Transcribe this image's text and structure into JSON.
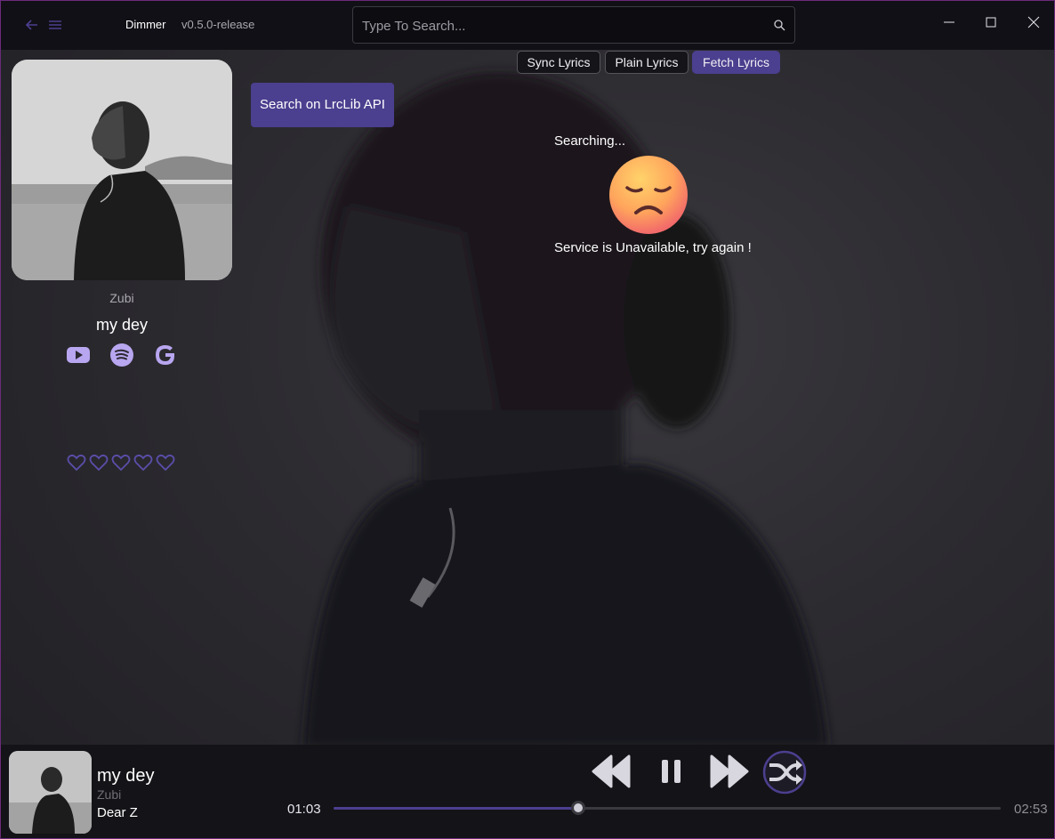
{
  "titlebar": {
    "app_name": "Dimmer",
    "version": "v0.5.0-release",
    "search_placeholder": "Type To Search...",
    "icons": [
      "back-arrow-icon",
      "hamburger-menu-icon",
      "search-icon",
      "minimize-icon",
      "maximize-icon",
      "close-icon"
    ]
  },
  "tabs": [
    {
      "label": "Sync Lyrics",
      "active": false
    },
    {
      "label": "Plain Lyrics",
      "active": false
    },
    {
      "label": "Fetch Lyrics",
      "active": true
    }
  ],
  "now_playing_panel": {
    "artist": "Zubi",
    "song": "my dey",
    "links": [
      "youtube-icon",
      "spotify-icon",
      "google-icon"
    ],
    "rating_hearts": 5,
    "rating_filled": 0
  },
  "lyrics_fetch": {
    "button_label": "Search on LrcLib API",
    "status": "Searching...",
    "emoji": "disappointed-face",
    "error": "Service is Unavailable, try again !"
  },
  "player": {
    "title": "my dey",
    "artist": "Zubi",
    "album": "Dear Z",
    "current_time": "01:03",
    "total_time": "02:53",
    "progress": 0.367,
    "controls": [
      "previous-icon",
      "pause-icon",
      "next-icon",
      "shuffle-icon"
    ],
    "shuffle_active": true
  },
  "colors": {
    "accent": "#4b3f8f",
    "accent_light": "#b8a6f0",
    "window_border": "#6a2b7a"
  }
}
